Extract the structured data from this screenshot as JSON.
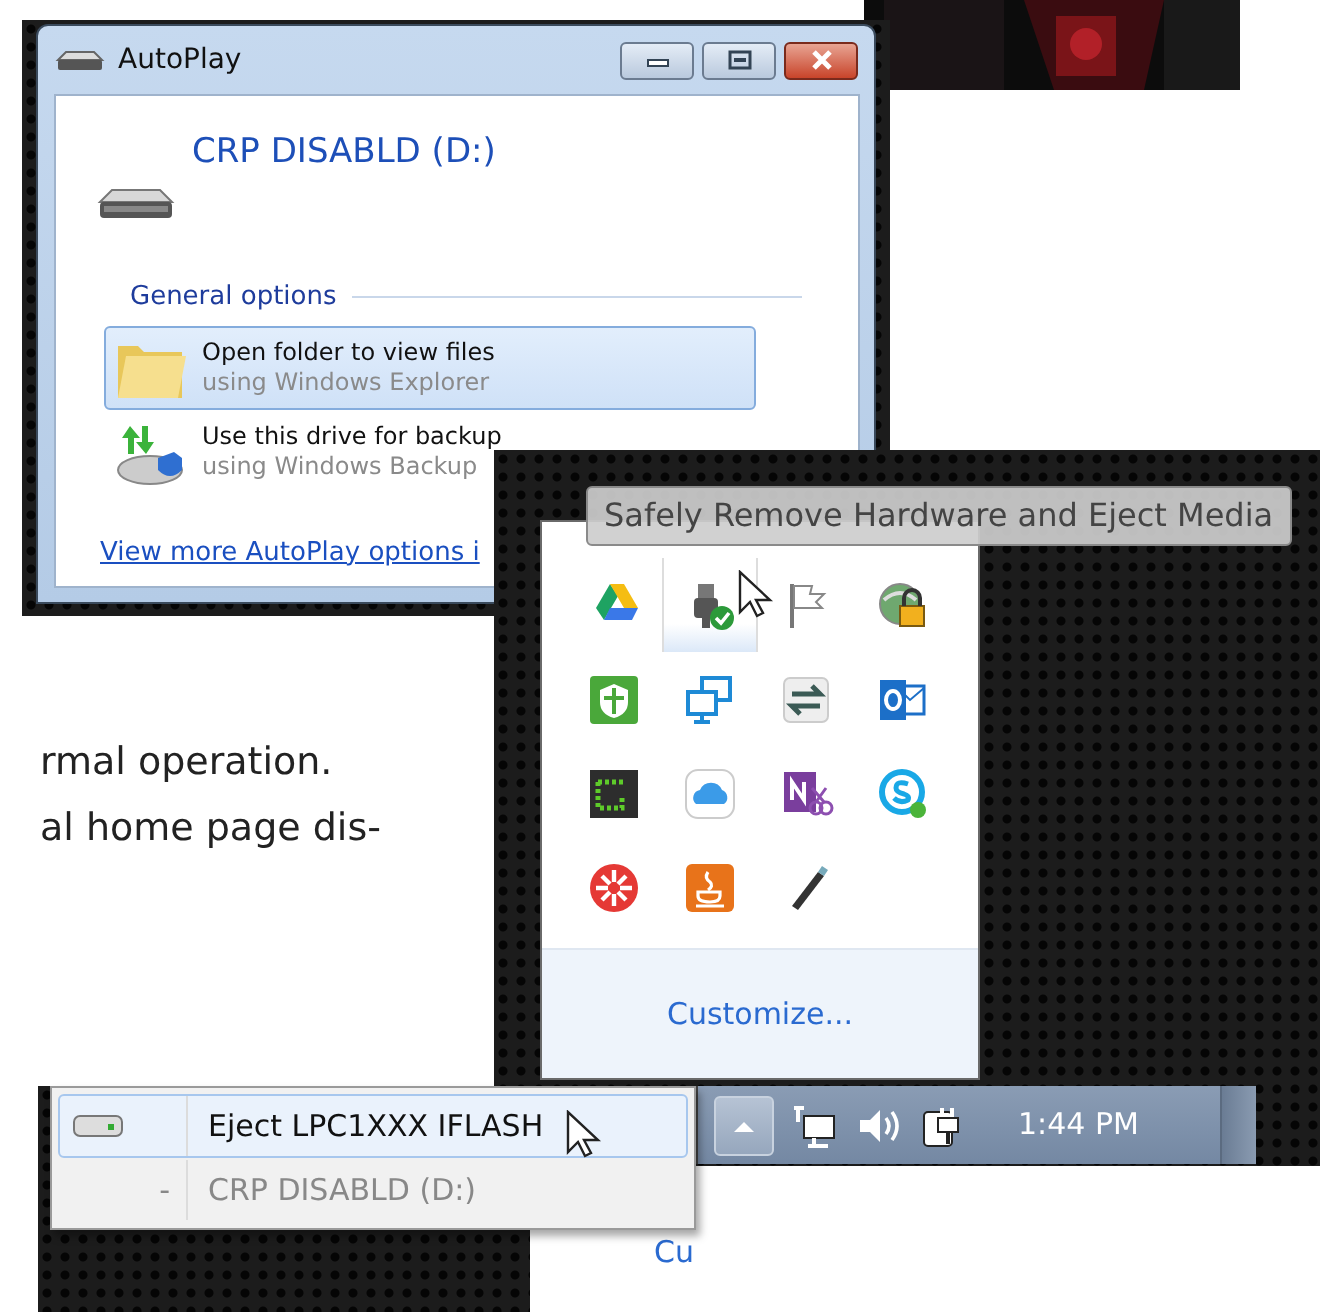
{
  "autoplay_window": {
    "title": "AutoPlay",
    "drive_label": "CRP DISABLD (D:)",
    "section_heading": "General options",
    "options": [
      {
        "kind": "folder",
        "title": "Open folder to view files",
        "subtitle": "using Windows Explorer",
        "selected": true
      },
      {
        "kind": "backup",
        "title": "Use this drive for backup",
        "subtitle": "using Windows Backup",
        "selected": false
      }
    ],
    "more_link": "View more AutoPlay options i"
  },
  "document_text": [
    "rmal operation.",
    "al home page dis-"
  ],
  "tray_overflow": {
    "tooltip": "Safely Remove Hardware and Eject Media",
    "icons": [
      {
        "kind": "drive",
        "selected": false
      },
      {
        "kind": "usb",
        "selected": true
      },
      {
        "kind": "flag",
        "selected": false
      },
      {
        "kind": "globe-lock",
        "selected": false
      },
      {
        "kind": "shield",
        "selected": false
      },
      {
        "kind": "network",
        "selected": false
      },
      {
        "kind": "sync",
        "selected": false
      },
      {
        "kind": "mail",
        "selected": false
      },
      {
        "kind": "terminal",
        "selected": false
      },
      {
        "kind": "cloud",
        "selected": false
      },
      {
        "kind": "note",
        "selected": false
      },
      {
        "kind": "chat",
        "selected": false
      },
      {
        "kind": "asterisk",
        "selected": false
      },
      {
        "kind": "cup",
        "selected": false
      },
      {
        "kind": "pen",
        "selected": false
      }
    ],
    "customize_link": "Customize..."
  },
  "eject_menu": {
    "items": [
      {
        "kind": "device",
        "label": "Eject LPC1XXX IFLASH",
        "selected": true
      },
      {
        "kind": "volume",
        "dash": "-",
        "label": "CRP DISABLD (D:)",
        "selected": false
      }
    ]
  },
  "background_popup": {
    "customize_link": "Cu"
  },
  "taskbar": {
    "clock": "1:44 PM"
  }
}
